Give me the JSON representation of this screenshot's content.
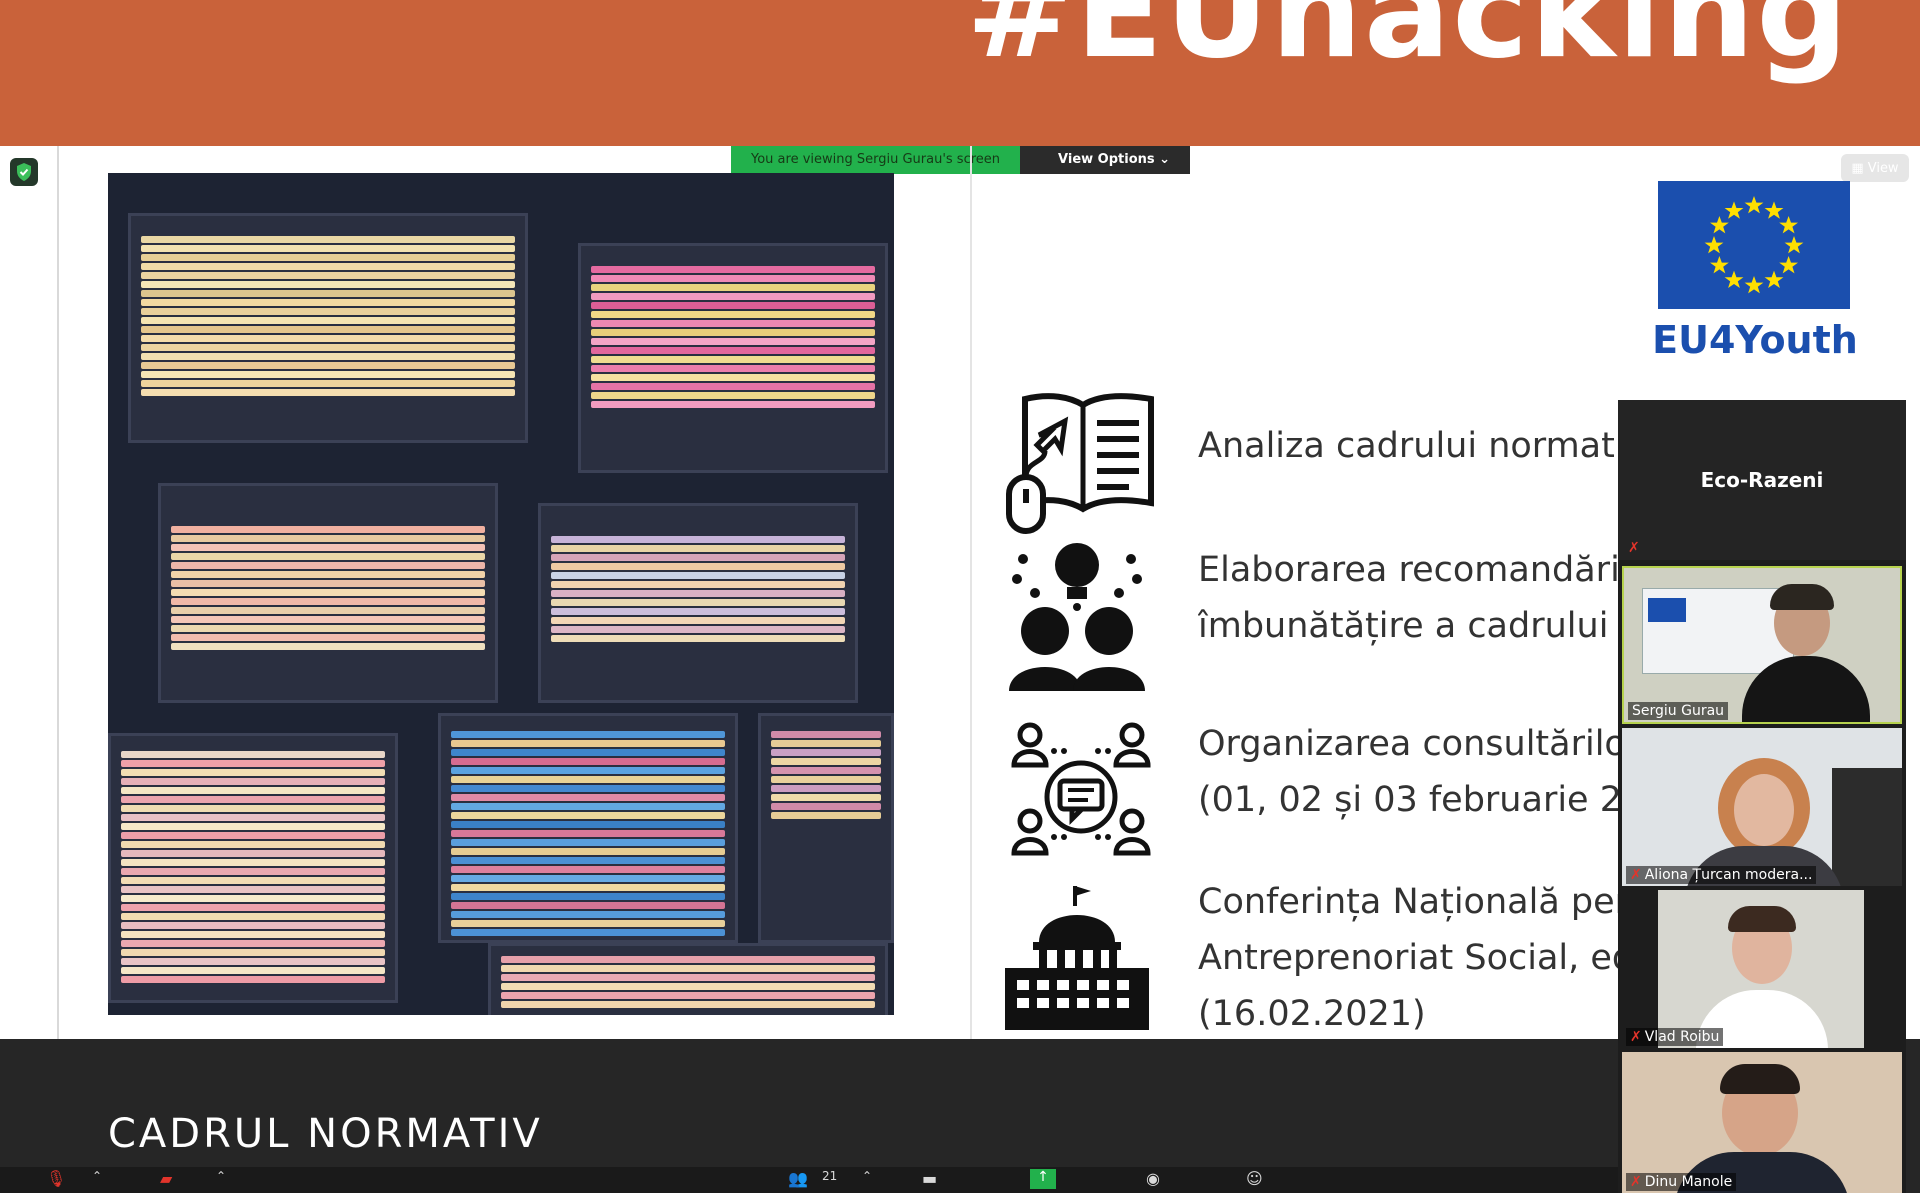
{
  "banner": {
    "hashtag": "#EUhacking",
    "color": "#c9623a"
  },
  "zoom": {
    "viewing_label": "You are viewing Sergiu Gurau's screen",
    "view_options_label": "View Options",
    "view_button_label": "View",
    "security_icon": "shield-check-icon"
  },
  "slide": {
    "logo_text": "EU4Youth",
    "items": [
      {
        "icon": "book-mouse-icon",
        "lines": [
          "Analiza cadrului normati"
        ]
      },
      {
        "icon": "people-idea-icon",
        "lines": [
          "Elaborarea recomandări",
          "îmbunătățire a cadrului n"
        ]
      },
      {
        "icon": "consultation-group-icon",
        "lines": [
          "Organizarea consultărilo",
          "(01, 02 și 03 februarie 202"
        ]
      },
      {
        "icon": "government-building-icon",
        "lines": [
          "Conferința Națională pen",
          "Antreprenoriat Social, ed",
          "(16.02.2021)"
        ]
      }
    ],
    "footer_title": "CADRUL NORMATIV"
  },
  "gallery": {
    "title": "Eco-Razeni",
    "participants": [
      {
        "name": "Sergiu Gurau",
        "muted": false
      },
      {
        "name": "Aliona Țurcan modera...",
        "muted": true
      },
      {
        "name": "Vlad Roibu",
        "muted": true
      },
      {
        "name": "Dinu Manole",
        "muted": true
      }
    ]
  },
  "toolbar": {
    "participants_count": "21"
  }
}
